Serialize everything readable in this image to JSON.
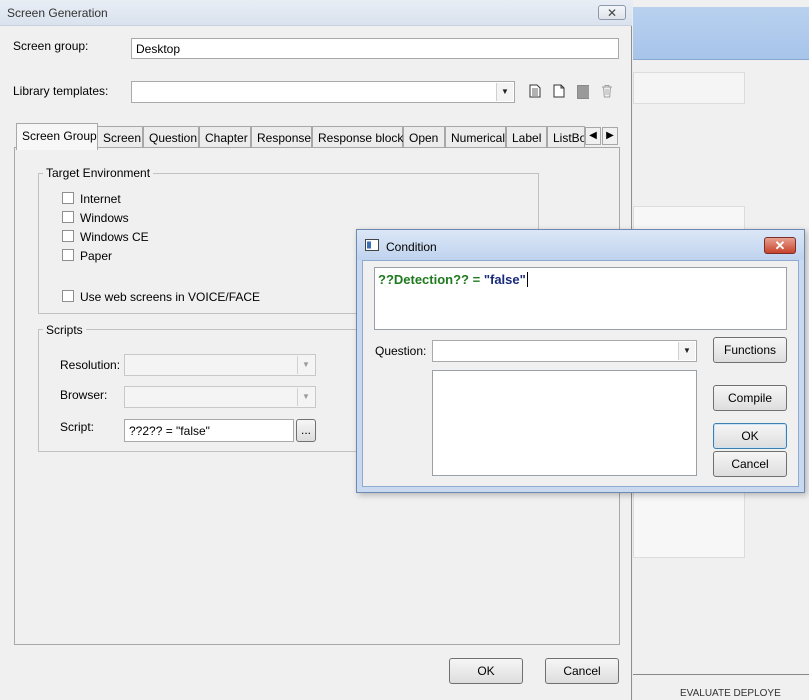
{
  "background_app": {
    "status_text": "EVALUATE DEPLOYE"
  },
  "screen_generation": {
    "title": "Screen Generation",
    "close_label": "✕",
    "screen_group_label": "Screen group:",
    "screen_group_value": "Desktop",
    "library_templates_label": "Library templates:",
    "library_templates_value": "",
    "tabs": [
      {
        "label": "Screen Group"
      },
      {
        "label": "Screen"
      },
      {
        "label": "Question"
      },
      {
        "label": "Chapter"
      },
      {
        "label": "Response"
      },
      {
        "label": "Response block"
      },
      {
        "label": "Open"
      },
      {
        "label": "Numerical"
      },
      {
        "label": "Label"
      },
      {
        "label": "ListBo"
      }
    ],
    "tab_scroll_left": "◀",
    "tab_scroll_right": "▶",
    "target_environment": {
      "title": "Target Environment",
      "options": [
        {
          "label": "Internet",
          "checked": false
        },
        {
          "label": "Windows",
          "checked": false
        },
        {
          "label": "Windows CE",
          "checked": false
        },
        {
          "label": "Paper",
          "checked": false
        }
      ],
      "voice_face_label": "Use web screens in VOICE/FACE",
      "voice_face_checked": false
    },
    "scripts": {
      "title": "Scripts",
      "resolution_label": "Resolution:",
      "resolution_value": "",
      "browser_label": "Browser:",
      "browser_value": "",
      "script_label": "Script:",
      "script_value": "??2?? = \"false\"",
      "ellipsis_label": "..."
    },
    "ok_label": "OK",
    "cancel_label": "Cancel"
  },
  "condition": {
    "title": "Condition",
    "close_label": "✕",
    "expression_identifier": "??Detection?? =",
    "expression_value": "\"false\"",
    "question_label": "Question:",
    "question_value": "",
    "functions_label": "Functions",
    "compile_label": "Compile",
    "ok_label": "OK",
    "cancel_label": "Cancel",
    "colors": {
      "identifier": "#1f7a1f",
      "string": "#1a2a7a"
    }
  }
}
